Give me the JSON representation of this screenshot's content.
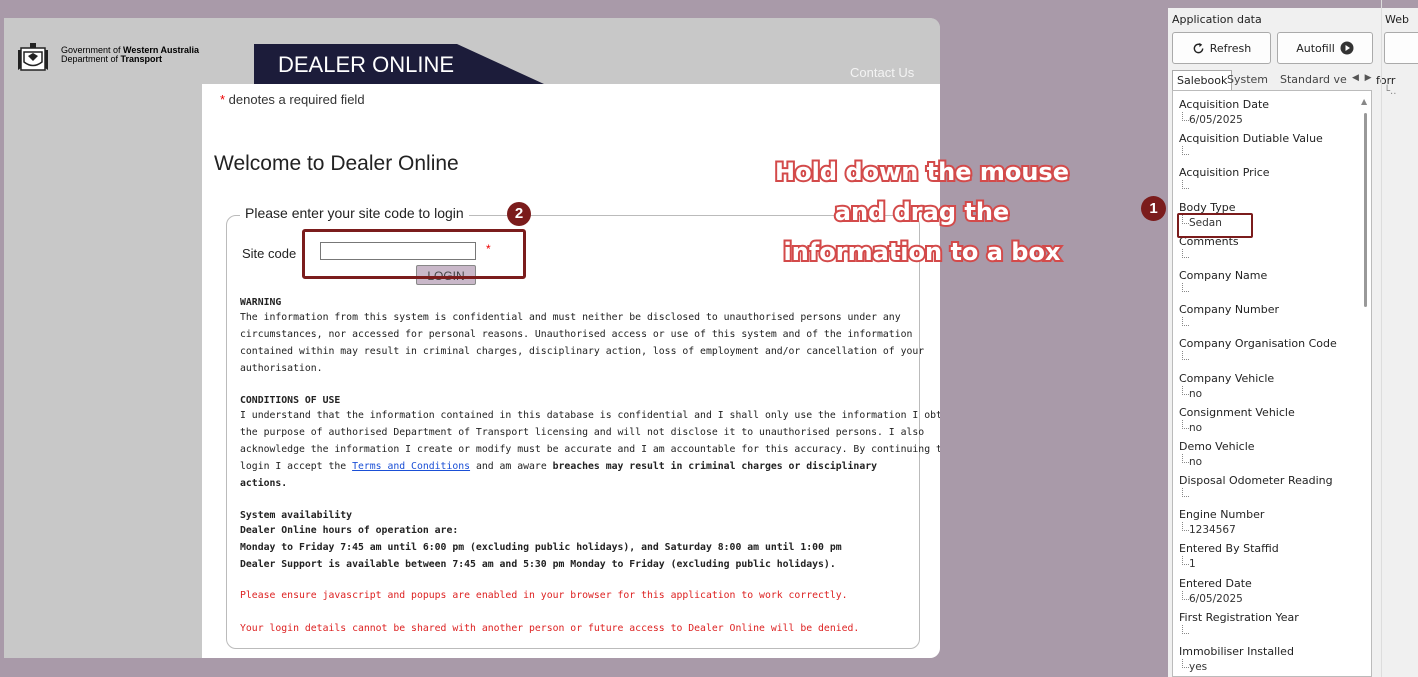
{
  "header": {
    "gov_line1_prefix": "Government of ",
    "gov_line1_bold": "Western Australia",
    "gov_line2_prefix": "Department of ",
    "gov_line2_bold": "Transport",
    "banner_title": "DEALER ONLINE",
    "contact_link": "Contact Us"
  },
  "form": {
    "required_star": "*",
    "required_note": " denotes a required field",
    "welcome": "Welcome to Dealer Online",
    "legend": "Please enter your site code to login",
    "site_label": "Site code",
    "site_value": "",
    "site_star": "*",
    "login_button": "LOGIN"
  },
  "notices": {
    "warning_heading": "WARNING",
    "warning_lines": [
      "The information from this system is confidential and must neither be disclosed to unauthorised persons under any",
      "circumstances, nor accessed for personal reasons. Unauthorised access or use of this system and of the information",
      "contained within may result in criminal charges, disciplinary action, loss of employment and/or cancellation of your",
      "authorisation."
    ],
    "conditions_heading": "CONDITIONS OF USE",
    "conditions_lines": [
      "I understand that the information contained in this database is confidential and I shall only use the information I obtain for",
      "the purpose of authorised Department of Transport licensing and will not disclose it to unauthorised persons. I also",
      "acknowledge the information I create or modify must be accurate and I am accountable for this accuracy. By continuing to"
    ],
    "conditions_last_prefix": "login I accept the ",
    "terms_link": "Terms and Conditions",
    "conditions_last_middle": " and am aware ",
    "conditions_last_bold": "breaches may result in criminal charges or disciplinary",
    "conditions_final_bold": "actions.",
    "availability_heading": "System availability",
    "availability_lines": [
      "Dealer Online hours of operation are:",
      "Monday to Friday 7:45 am until 6:00 pm (excluding public holidays), and Saturday 8:00 am until 1:00 pm",
      "Dealer Support is available between 7:45 am and 5:30 pm Monday to Friday (excluding public holidays)."
    ],
    "js_notice": "Please ensure javascript and popups are enabled in your browser for this application to work correctly.",
    "share_notice": "Your login details cannot be shared with another person or future access to Dealer Online will be denied."
  },
  "overlay": {
    "instruction_lines": [
      "Hold down the mouse",
      "and drag the",
      "information to a box"
    ],
    "badge1": "1",
    "badge2": "2"
  },
  "app_panel": {
    "title": "Application data",
    "web_title": "Web",
    "refresh_label": "Refresh",
    "autofill_label": "Autofill",
    "tabs": [
      "Salebook",
      "System",
      "Standard ve"
    ],
    "form_col_label": "forr",
    "fields": [
      {
        "label": "Acquisition Date",
        "value": "6/05/2025"
      },
      {
        "label": "Acquisition Dutiable Value",
        "value": ""
      },
      {
        "label": "Acquisition Price",
        "value": ""
      },
      {
        "label": "Body Type",
        "value": "Sedan"
      },
      {
        "label": "Comments",
        "value": ""
      },
      {
        "label": "Company Name",
        "value": ""
      },
      {
        "label": "Company Number",
        "value": ""
      },
      {
        "label": "Company Organisation Code",
        "value": ""
      },
      {
        "label": "Company Vehicle",
        "value": "no"
      },
      {
        "label": "Consignment Vehicle",
        "value": "no"
      },
      {
        "label": "Demo Vehicle",
        "value": "no"
      },
      {
        "label": "Disposal Odometer Reading",
        "value": ""
      },
      {
        "label": "Engine Number",
        "value": "1234567"
      },
      {
        "label": "Entered By Staffid",
        "value": "1"
      },
      {
        "label": "Entered Date",
        "value": "6/05/2025"
      },
      {
        "label": "First Registration Year",
        "value": ""
      },
      {
        "label": "Immobiliser Installed",
        "value": "yes"
      }
    ]
  },
  "colors": {
    "accent_dark_red": "#7b1c1c",
    "banner_navy": "#1c1c3a",
    "instruction_stroke": "#d34a4a"
  }
}
